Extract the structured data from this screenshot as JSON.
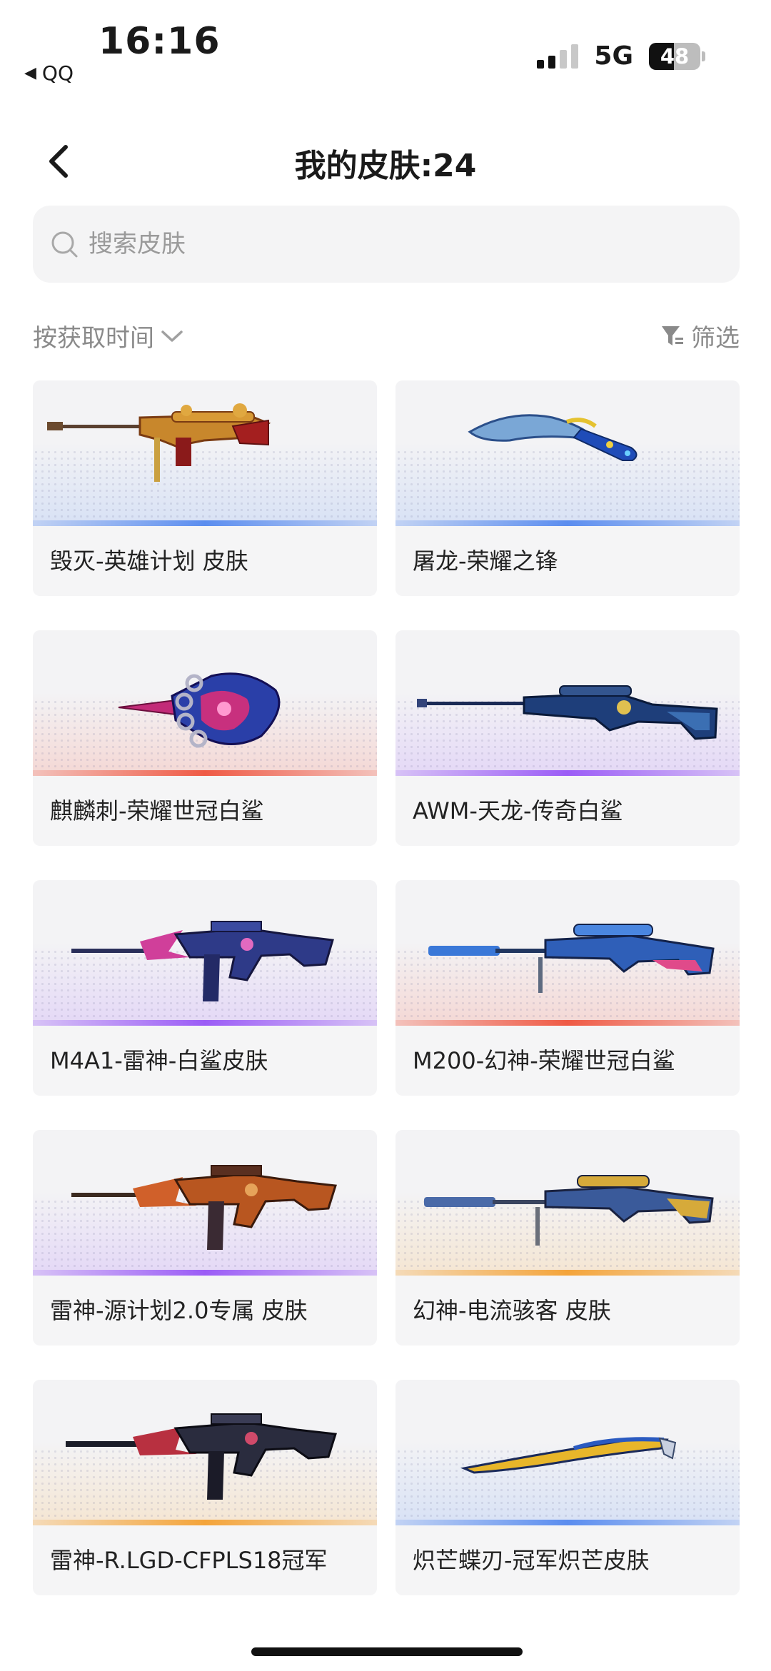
{
  "status_bar": {
    "time": "16:16",
    "back_app": "QQ",
    "network": "5G",
    "battery": "48",
    "battery_level_percent": 48,
    "signal_bars_active": 2
  },
  "header": {
    "title": "我的皮肤:24"
  },
  "search": {
    "placeholder": "搜索皮肤"
  },
  "toolbar": {
    "sort_label": "按获取时间",
    "filter_label": "筛选"
  },
  "colors": {
    "blue": "#5b8def",
    "red": "#ef5a45",
    "purple": "#9b5cf6",
    "orange": "#f4a43a"
  },
  "skins": [
    {
      "name": "毁灭-英雄计划 皮肤",
      "rarity_color": "#5b8def",
      "icon": "sniper-rifle-gold-icon"
    },
    {
      "name": "屠龙-荣耀之锋",
      "rarity_color": "#5b8def",
      "icon": "blue-knife-icon"
    },
    {
      "name": "麒麟刺-荣耀世冠白鲨",
      "rarity_color": "#ef5a45",
      "icon": "knuckle-blade-icon"
    },
    {
      "name": "AWM-天龙-传奇白鲨",
      "rarity_color": "#9b5cf6",
      "icon": "awm-rifle-icon"
    },
    {
      "name": "M4A1-雷神-白鲨皮肤",
      "rarity_color": "#9b5cf6",
      "icon": "assault-rifle-pink-icon"
    },
    {
      "name": "M200-幻神-荣耀世冠白鲨",
      "rarity_color": "#ef5a45",
      "icon": "sniper-rifle-blue-icon"
    },
    {
      "name": "雷神-源计划2.0专属 皮肤",
      "rarity_color": "#9b5cf6",
      "icon": "assault-rifle-orange-icon"
    },
    {
      "name": "幻神-电流骇客 皮肤",
      "rarity_color": "#f4a43a",
      "icon": "sniper-rifle-gold-blue-icon"
    },
    {
      "name": "雷神-R.LGD-CFPLS18冠军",
      "rarity_color": "#f4a43a",
      "icon": "assault-rifle-black-icon"
    },
    {
      "name": "炽芒蝶刃-冠军炽芒皮肤",
      "rarity_color": "#5b8def",
      "icon": "butterfly-blade-icon"
    }
  ]
}
